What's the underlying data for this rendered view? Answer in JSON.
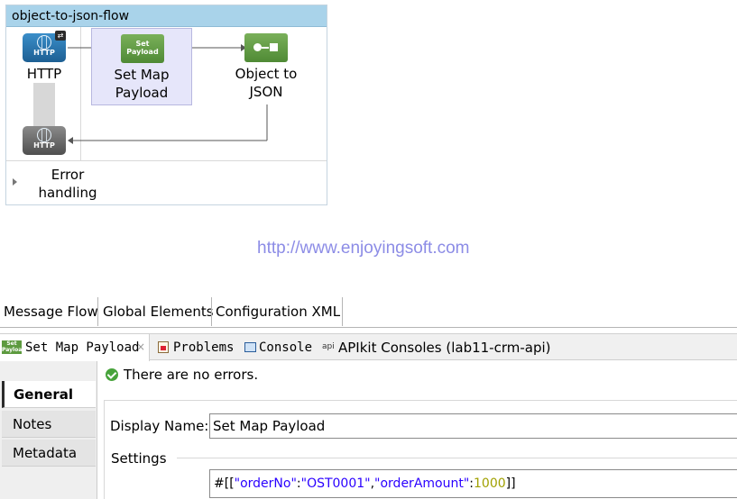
{
  "flow": {
    "title": "object-to-json-flow",
    "source_label": "HTTP",
    "source_icon_text": "HTTP",
    "response_icon_text": "HTTP",
    "set_payload_icon_text": [
      "Set",
      "Payload"
    ],
    "set_payload_label": [
      "Set Map",
      "Payload"
    ],
    "object_to_json_label": [
      "Object to",
      "JSON"
    ],
    "error_handling_label": [
      "Error",
      "handling"
    ]
  },
  "watermark": "http://www.enjoyingsoft.com",
  "editor_tabs": [
    "Message Flow",
    "Global Elements",
    "Configuration XML"
  ],
  "view_tabs": {
    "active": "Set Map Payload",
    "set_payload_icon_text": [
      "Set",
      "Payload"
    ],
    "problems": "Problems",
    "console": "Console",
    "apikit_tag": "api",
    "apikit": "APIkit Consoles (lab11-crm-api)"
  },
  "nav": [
    "General",
    "Notes",
    "Metadata"
  ],
  "status": "There are no errors.",
  "form": {
    "display_name_label": "Display Name:",
    "display_name_value": "Set Map Payload",
    "settings_label": "Settings",
    "payload_parts": [
      "#[[",
      "\"orderNo\"",
      ":",
      "\"OST0001\"",
      ",",
      "\"orderAmount\"",
      ":",
      "1000",
      "]]"
    ]
  },
  "colors": {
    "flow_header": "#a9d3ea",
    "selection": "#e6e6fa",
    "http_icon": "#2a73ad",
    "processor_icon": "#5d9a3f",
    "watermark": "#8c8ce6",
    "mel_string": "#2a00ff",
    "mel_number": "#a0a000"
  }
}
